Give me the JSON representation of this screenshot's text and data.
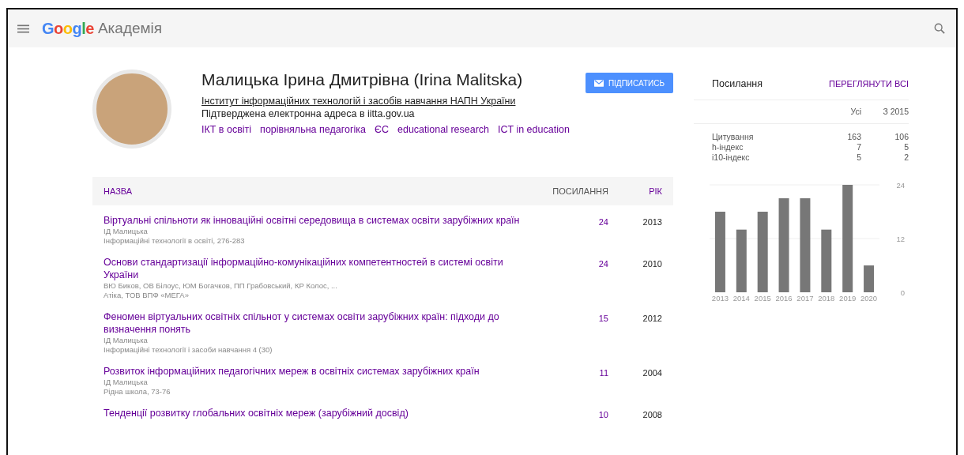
{
  "header": {
    "logo": "Google",
    "product": "Академія"
  },
  "profile": {
    "name": "Малицька Ірина Дмитрівна (Irina Malitska)",
    "affiliation": "Інститут інформаційних технологій і засобів навчання НАПН України",
    "email_note": "Підтверджена електронна адреса в iitta.gov.ua",
    "interests": [
      "ІКТ в освіті",
      "порівняльна педагогіка",
      "ЄС",
      "educational research",
      "ICT in education"
    ],
    "follow_button": "ПІДПИСАТИСЬ"
  },
  "table": {
    "columns": [
      "НАЗВА",
      "ПОСИЛАННЯ",
      "РІК"
    ],
    "rows": [
      {
        "title": "Віртуальні спільноти як інноваційні освітні середовища в системах освіти зарубіжних країн",
        "authors": "ІД Малицька",
        "source": "Інформаційні технології в освіті, 276-283",
        "cited": "24",
        "year": "2013"
      },
      {
        "title": "Основи стандартизації інформаційно-комунікаційних компетентностей в системі освіти України",
        "authors": "ВЮ Биков, ОВ Білоус, ЮМ Богачков, ПП Грабовський, КР Колос, ...",
        "source": "Атіка, ТОВ ВПФ «МЕГА»",
        "cited": "24",
        "year": "2010"
      },
      {
        "title": "Феномен віртуальних освітніх спільнот у системах освіти зарубіжних країн: підходи до визначення понять",
        "authors": "ІД Малицька",
        "source": "Інформаційні технології і засоби навчання 4 (30)",
        "cited": "15",
        "year": "2012"
      },
      {
        "title": "Розвиток інформаційних педагогічних мереж в освітніх системах зарубіжних країн",
        "authors": "ІД Малицька",
        "source": "Рідна школа, 73-76",
        "cited": "11",
        "year": "2004"
      },
      {
        "title": "Тенденції розвитку глобальних освітніх мереж (зарубіжний досвід)",
        "cited": "10",
        "year": "2008"
      }
    ]
  },
  "citations": {
    "title": "Посилання",
    "view_all": "ПЕРЕГЛЯНУТИ ВСІ",
    "columns": [
      "Усі",
      "З 2015"
    ],
    "rows": [
      {
        "label": "Цитування",
        "all": "163",
        "since": "106"
      },
      {
        "label": "h-індекс",
        "all": "7",
        "since": "5"
      },
      {
        "label": "i10-індекс",
        "all": "5",
        "since": "2"
      }
    ],
    "chart_data": {
      "type": "bar",
      "categories": [
        "2013",
        "2014",
        "2015",
        "2016",
        "2017",
        "2018",
        "2019",
        "2020"
      ],
      "values": [
        18,
        14,
        18,
        21,
        21,
        14,
        24,
        6
      ],
      "ylim": [
        0,
        24
      ],
      "yticks": [
        0,
        12,
        24
      ]
    }
  }
}
